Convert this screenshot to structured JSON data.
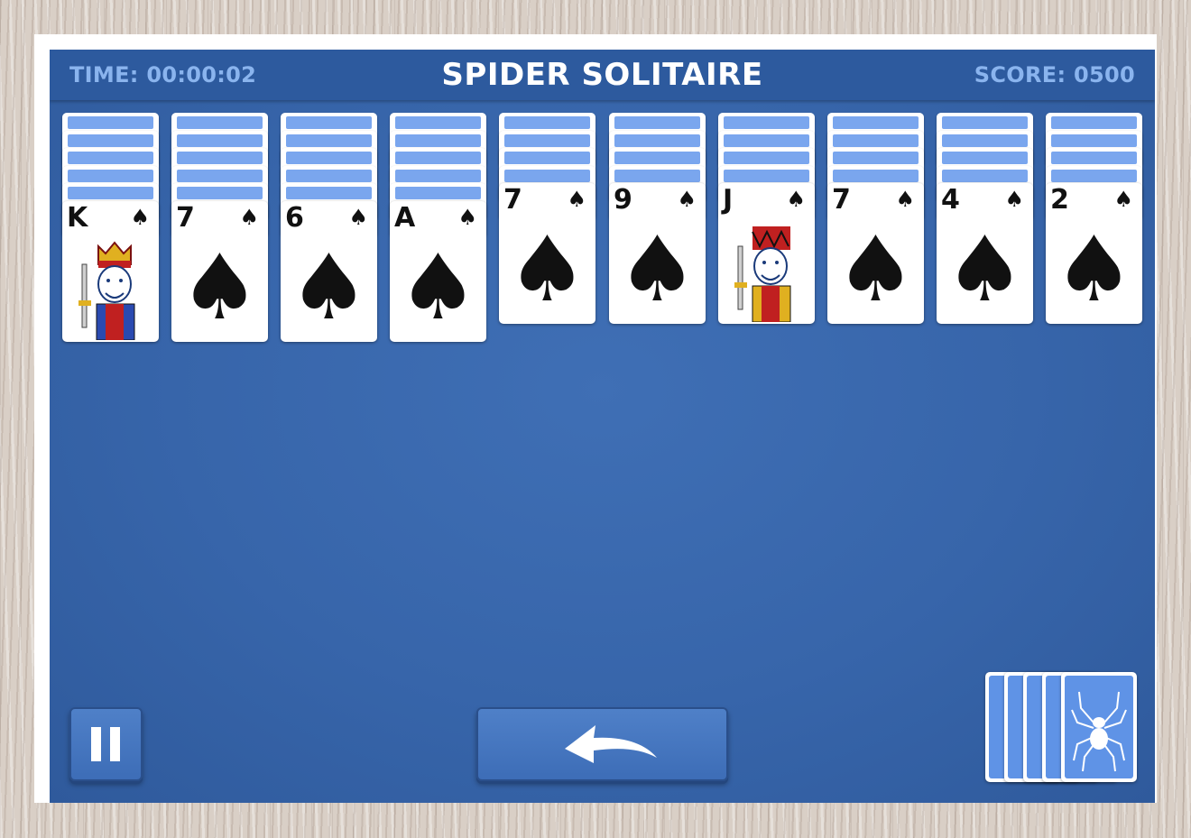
{
  "header": {
    "time_label": "TIME: 00:00:02",
    "title": "SPIDER SOLITAIRE",
    "score_label": "SCORE: 0500"
  },
  "tableau": [
    {
      "facedown": 5,
      "rank": "K",
      "suit": "♠",
      "face_card": true
    },
    {
      "facedown": 5,
      "rank": "7",
      "suit": "♠",
      "face_card": false
    },
    {
      "facedown": 5,
      "rank": "6",
      "suit": "♠",
      "face_card": false
    },
    {
      "facedown": 5,
      "rank": "A",
      "suit": "♠",
      "face_card": false
    },
    {
      "facedown": 4,
      "rank": "7",
      "suit": "♠",
      "face_card": false
    },
    {
      "facedown": 4,
      "rank": "9",
      "suit": "♠",
      "face_card": false
    },
    {
      "facedown": 4,
      "rank": "J",
      "suit": "♠",
      "face_card": true
    },
    {
      "facedown": 4,
      "rank": "7",
      "suit": "♠",
      "face_card": false
    },
    {
      "facedown": 4,
      "rank": "4",
      "suit": "♠",
      "face_card": false
    },
    {
      "facedown": 4,
      "rank": "2",
      "suit": "♠",
      "face_card": false
    }
  ],
  "stock": {
    "remaining_deals": 5
  },
  "controls": {
    "pause_icon": "pause-icon",
    "undo_icon": "undo-arrow-icon",
    "stock_icon": "spider-icon"
  },
  "colors": {
    "table": "#3765aa",
    "card_back": "#7aa6ee",
    "header_text": "#8ab4ee"
  }
}
